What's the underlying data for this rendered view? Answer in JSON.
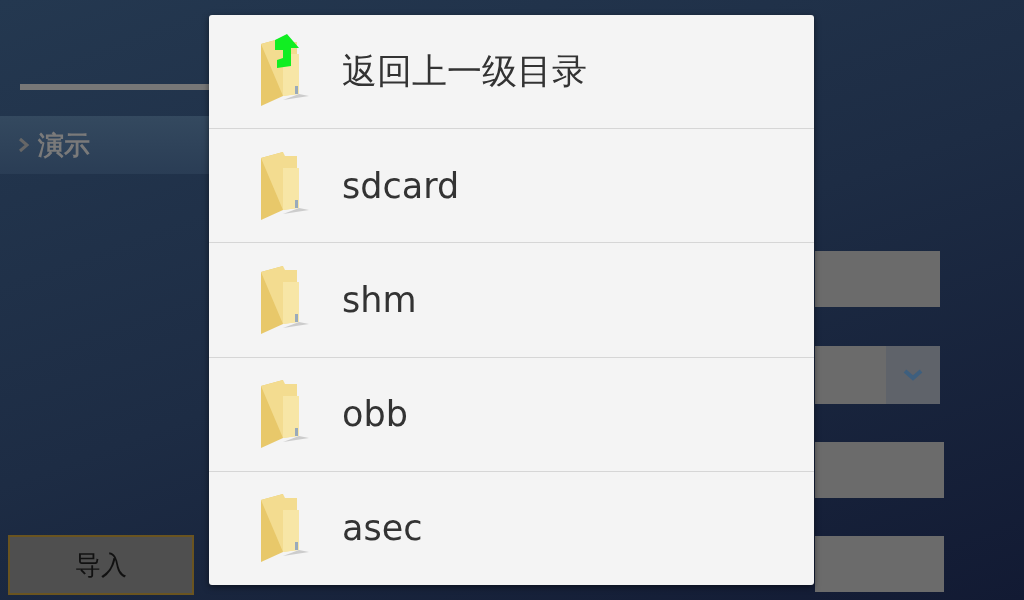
{
  "sidebar": {
    "items": [
      {
        "label": "演示",
        "selected": true
      }
    ]
  },
  "import_button": "导入",
  "dialog": {
    "items": [
      {
        "kind": "up",
        "label": "返回上一级目录"
      },
      {
        "kind": "folder",
        "label": "sdcard"
      },
      {
        "kind": "folder",
        "label": "shm"
      },
      {
        "kind": "folder",
        "label": "obb"
      },
      {
        "kind": "folder",
        "label": "asec"
      }
    ]
  }
}
